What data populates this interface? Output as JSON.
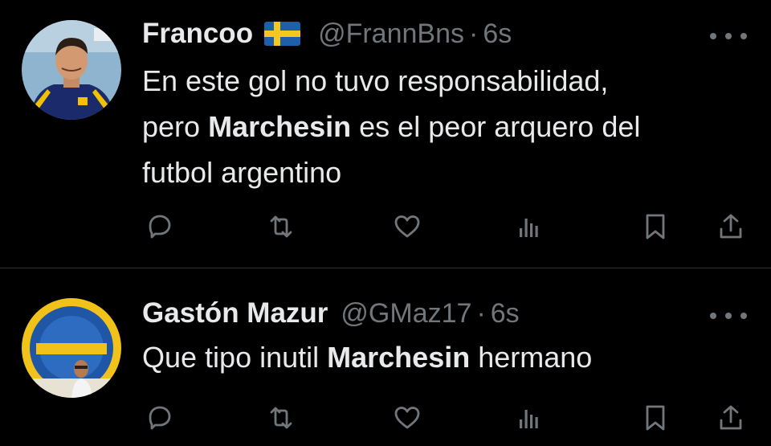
{
  "tweets": [
    {
      "name": "Francoo",
      "flag": "sweden-flag",
      "handle": "@FrannBns",
      "separator": "·",
      "time": "6s",
      "body": [
        {
          "text": "En este gol no tuvo responsabilidad,",
          "bold": false,
          "br": true
        },
        {
          "text": "pero ",
          "bold": false
        },
        {
          "text": "Marchesin",
          "bold": true
        },
        {
          "text": " es el peor arquero del",
          "bold": false,
          "br": true
        },
        {
          "text": "futbol argentino",
          "bold": false
        }
      ]
    },
    {
      "name": "Gastón Mazur",
      "handle": "@GMaz17",
      "separator": "·",
      "time": "6s",
      "body": [
        {
          "text": "Que tipo inutil ",
          "bold": false
        },
        {
          "text": "Marchesin",
          "bold": true
        },
        {
          "text": " hermano",
          "bold": false
        }
      ]
    }
  ],
  "actions": [
    "reply-icon",
    "retweet-icon",
    "like-icon",
    "views-icon",
    "bookmark-icon",
    "share-icon"
  ],
  "colors": {
    "background": "#000000",
    "text": "#e7e9ea",
    "muted": "#71767b",
    "divider": "#2f3336"
  }
}
